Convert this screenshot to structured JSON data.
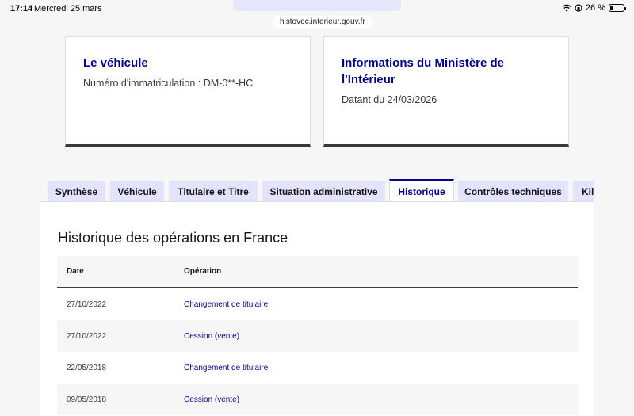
{
  "status_bar": {
    "time": "17:14",
    "date": "Mercredi 25 mars",
    "battery": "26 %",
    "battery_level": 0.26
  },
  "browser": {
    "url": "histovec.interieur.gouv.fr"
  },
  "cards": {
    "vehicle": {
      "title": "Le véhicule",
      "text": "Numéro d'immatriculation : DM-0**-HC"
    },
    "ministry": {
      "title_line1": "Informations du Ministère de",
      "title_line2": "l'Intérieur",
      "text": "Datant du 24/03/2026"
    }
  },
  "tabs": [
    {
      "label": "Synthèse"
    },
    {
      "label": "Véhicule"
    },
    {
      "label": "Titulaire et Titre"
    },
    {
      "label": "Situation administrative"
    },
    {
      "label": "Historique"
    },
    {
      "label": "Contrôles techniques"
    },
    {
      "label": "Kilométrage"
    }
  ],
  "panel": {
    "title": "Historique des opérations en France",
    "columns": {
      "date": "Date",
      "operation": "Opération"
    },
    "rows": [
      {
        "date": "27/10/2022",
        "operation": "Changement de titulaire"
      },
      {
        "date": "27/10/2022",
        "operation": "Cession (vente)"
      },
      {
        "date": "22/05/2018",
        "operation": "Changement de titulaire"
      },
      {
        "date": "09/05/2018",
        "operation": "Cession (vente)"
      }
    ]
  },
  "colors": {
    "accent": "#000091",
    "tab_bg": "#e3e3fd",
    "border_dark": "#3a3a3a"
  }
}
